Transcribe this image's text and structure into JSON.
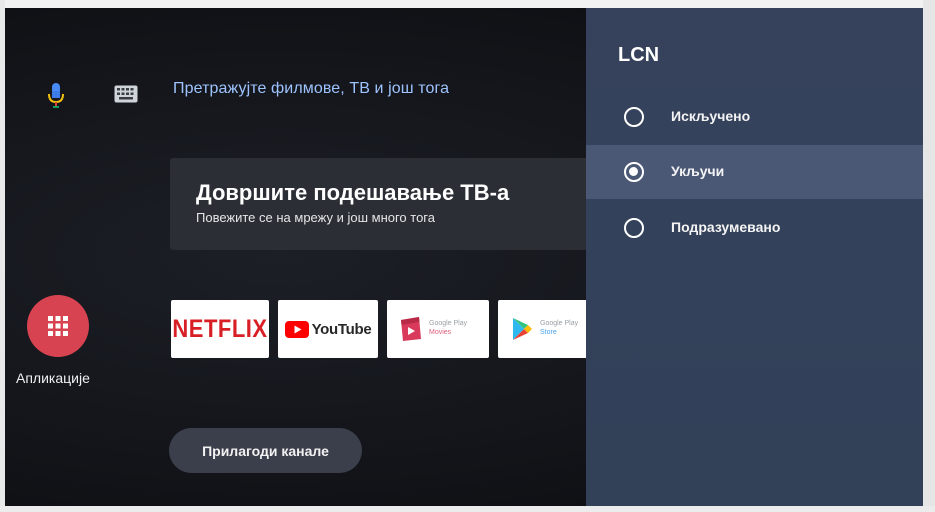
{
  "search": {
    "text": "Претражујте филмове, ТВ и још тога"
  },
  "setup_card": {
    "title": "Довршите подешавање ТВ-а",
    "subtitle": "Повежите се на мрежу и још много тога"
  },
  "apps": {
    "label": "Апликације"
  },
  "app_tiles": [
    {
      "name": "NETFLIX"
    },
    {
      "name": "YouTube"
    },
    {
      "name": "Google Play",
      "sub": "Movies"
    },
    {
      "name": "Google Play",
      "sub": "Store"
    }
  ],
  "customize": {
    "label": "Прилагоди канале"
  },
  "panel": {
    "title": "LCN",
    "options": [
      {
        "label": "Искључено",
        "selected": false
      },
      {
        "label": "Укључи",
        "selected": true
      },
      {
        "label": "Подразумевано",
        "selected": false
      }
    ]
  },
  "colors": {
    "search_text": "#9ec3ff",
    "apps_red": "#d84352",
    "netflix_red": "#d81f26",
    "panel_bg": "#36425c",
    "panel_selected": "#4a5876"
  },
  "icons": {
    "mic": "microphone-icon",
    "keyboard": "keyboard-icon",
    "apps_grid": "grid-icon"
  }
}
